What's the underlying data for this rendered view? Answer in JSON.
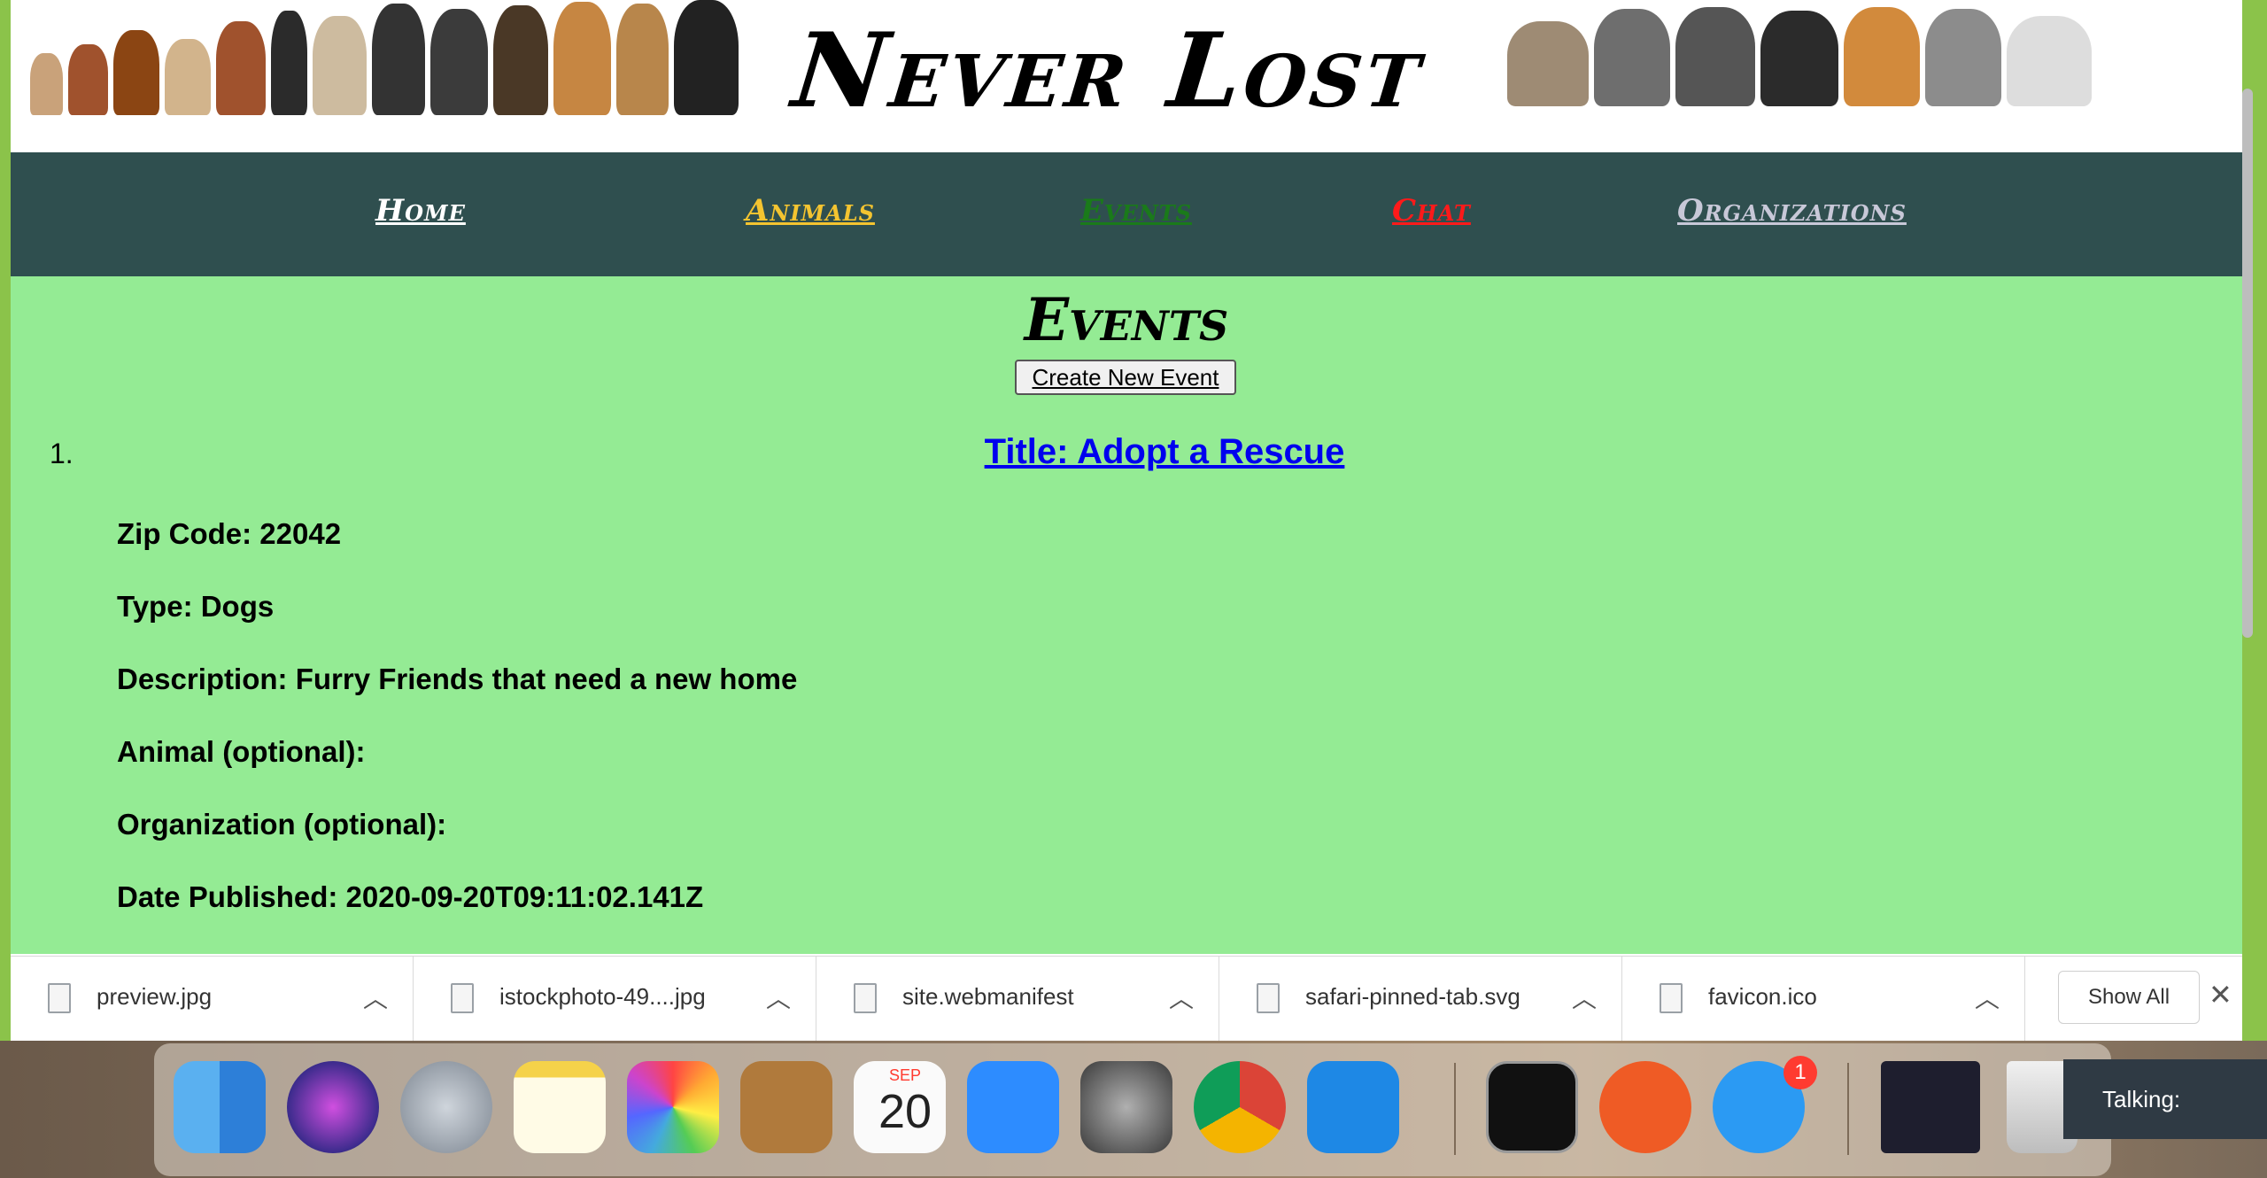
{
  "header": {
    "site_title": "Never Lost"
  },
  "nav": {
    "items": [
      {
        "label": "Home",
        "color": "#ffffff"
      },
      {
        "label": "Animals",
        "color": "#f4c430"
      },
      {
        "label": "Events",
        "color": "#1a7a1a"
      },
      {
        "label": "Chat",
        "color": "#ff1a1a"
      },
      {
        "label": "Organizations",
        "color": "#c8c8d8"
      }
    ]
  },
  "main": {
    "heading": "Events",
    "create_button": "Create New Event",
    "events": [
      {
        "number": "1.",
        "title": "Title: Adopt a Rescue",
        "zip": "Zip Code: 22042",
        "type": "Type: Dogs",
        "description": "Description: Furry Friends that need a new home",
        "animal": "Animal (optional):",
        "organization": "Organization (optional):",
        "date_published": "Date Published: 2020-09-20T09:11:02.141Z"
      }
    ]
  },
  "downloads": {
    "items": [
      {
        "name": "preview.jpg"
      },
      {
        "name": "istockphoto-49....jpg"
      },
      {
        "name": "site.webmanifest"
      },
      {
        "name": "safari-pinned-tab.svg"
      },
      {
        "name": "favicon.ico"
      }
    ],
    "show_all": "Show All",
    "close": "✕"
  },
  "dock": {
    "calendar_month": "SEP",
    "calendar_day": "20",
    "messages_badge": "1",
    "apps": [
      "finder",
      "siri",
      "launchpad",
      "notes",
      "photos",
      "contacts",
      "calendar",
      "zoom",
      "system-preferences",
      "chrome",
      "vscode",
      "activity-monitor",
      "postman",
      "messages",
      "vscode-window",
      "trash"
    ]
  },
  "overlay": {
    "talking_label": "Talking:"
  }
}
